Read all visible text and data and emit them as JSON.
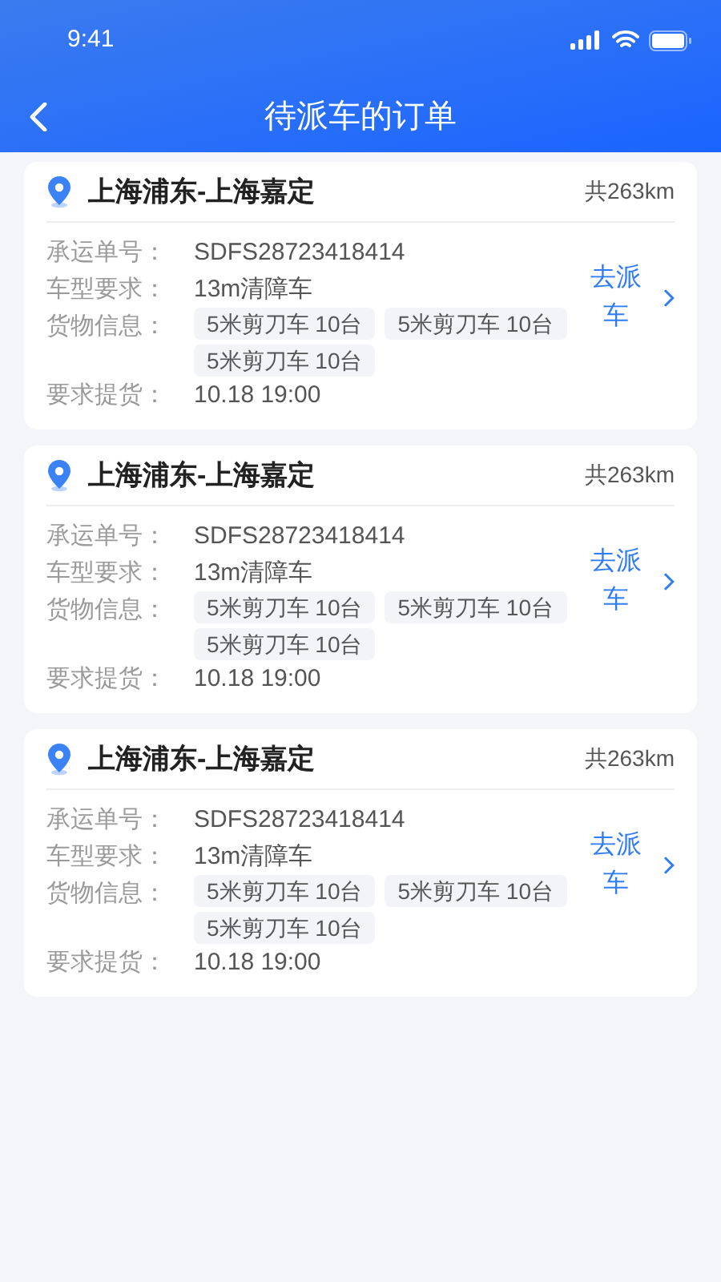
{
  "status_bar": {
    "time": "9:41"
  },
  "nav": {
    "title": "待派车的订单"
  },
  "orders": [
    {
      "route": "上海浦东-上海嘉定",
      "distance": "共263km",
      "waybill": {
        "label": "承运单号：",
        "value": "SDFS28723418414"
      },
      "vehicle": {
        "label": "车型要求：",
        "value": "13m清障车"
      },
      "cargo": {
        "label": "货物信息：",
        "tags": [
          "5米剪刀车 10台",
          "5米剪刀车 10台",
          "5米剪刀车 10台"
        ]
      },
      "pickup": {
        "label": "要求提货：",
        "value": "10.18 19:00"
      },
      "action": "去派车"
    },
    {
      "route": "上海浦东-上海嘉定",
      "distance": "共263km",
      "waybill": {
        "label": "承运单号：",
        "value": "SDFS28723418414"
      },
      "vehicle": {
        "label": "车型要求：",
        "value": "13m清障车"
      },
      "cargo": {
        "label": "货物信息：",
        "tags": [
          "5米剪刀车 10台",
          "5米剪刀车 10台",
          "5米剪刀车 10台"
        ]
      },
      "pickup": {
        "label": "要求提货：",
        "value": "10.18 19:00"
      },
      "action": "去派车"
    },
    {
      "route": "上海浦东-上海嘉定",
      "distance": "共263km",
      "waybill": {
        "label": "承运单号：",
        "value": "SDFS28723418414"
      },
      "vehicle": {
        "label": "车型要求：",
        "value": "13m清障车"
      },
      "cargo": {
        "label": "货物信息：",
        "tags": [
          "5米剪刀车 10台",
          "5米剪刀车 10台",
          "5米剪刀车 10台"
        ]
      },
      "pickup": {
        "label": "要求提货：",
        "value": "10.18 19:00"
      },
      "action": "去派车"
    }
  ]
}
